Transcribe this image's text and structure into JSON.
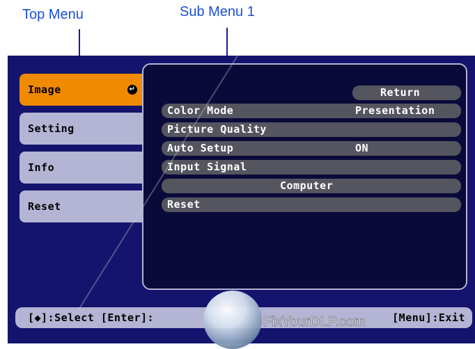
{
  "callouts": {
    "top_menu": "Top Menu",
    "sub_menu": "Sub Menu 1"
  },
  "top_menu": {
    "items": [
      {
        "label": "Image",
        "selected": true
      },
      {
        "label": "Setting",
        "selected": false
      },
      {
        "label": "Info",
        "selected": false
      },
      {
        "label": "Reset",
        "selected": false
      }
    ],
    "enter_icon": "enter-arrow-icon"
  },
  "sub_menu": {
    "return_label": "Return",
    "rows": [
      {
        "label": "Color Mode",
        "value": "Presentation"
      },
      {
        "label": "Picture Quality",
        "value": ""
      },
      {
        "label": "Auto Setup",
        "value": "ON"
      },
      {
        "label": "Input Signal",
        "value": ""
      },
      {
        "label": "",
        "value": "Computer"
      },
      {
        "label": "Reset",
        "value": ""
      }
    ]
  },
  "help_bar": {
    "left": "[◆]:Select [Enter]:",
    "right": "[Menu]:Exit"
  },
  "watermark": {
    "text": "FixYourDLP.com"
  },
  "colors": {
    "osd_background": "#14146e",
    "selected_item": "#f08a00",
    "item_background": "#b4b4d4",
    "callout_text": "#1a4fd6"
  }
}
